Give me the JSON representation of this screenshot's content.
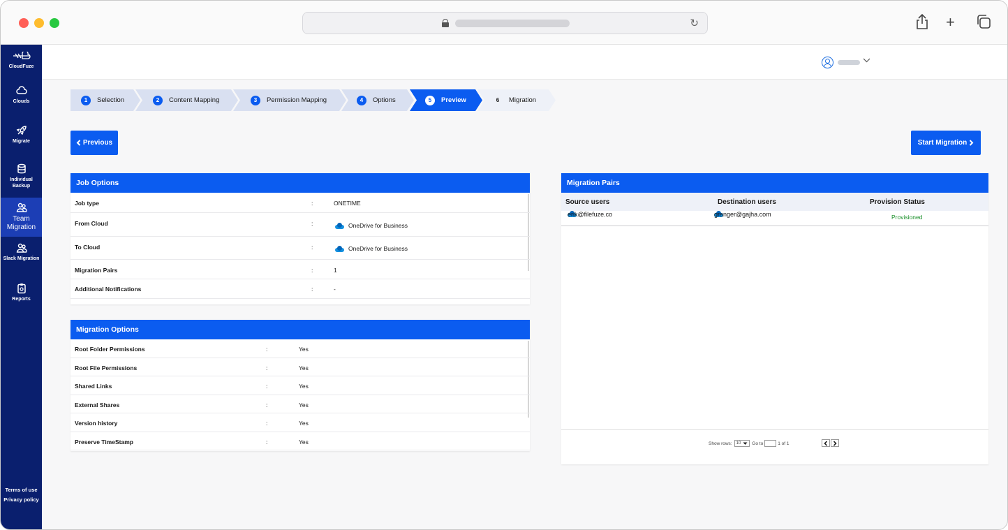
{
  "sidebar": {
    "logo_label": "CloudFuze",
    "items": [
      {
        "label": "Clouds",
        "icon": "cloud-icon"
      },
      {
        "label": "Migrate",
        "icon": "rocket-icon"
      },
      {
        "label": "Individual Backup",
        "icon": "database-icon"
      },
      {
        "label": "Team Migration",
        "icon": "team-icon"
      },
      {
        "label": "Slack Migration",
        "icon": "team-icon"
      },
      {
        "label": "Reports",
        "icon": "clipboard-icon"
      }
    ],
    "footer": {
      "terms": "Terms of use",
      "privacy": "Privacy policy"
    }
  },
  "stepper": [
    {
      "num": "1",
      "label": "Selection",
      "state": "done"
    },
    {
      "num": "2",
      "label": "Content Mapping",
      "state": "done"
    },
    {
      "num": "3",
      "label": "Permission Mapping",
      "state": "done"
    },
    {
      "num": "4",
      "label": "Options",
      "state": "done"
    },
    {
      "num": "5",
      "label": "Preview",
      "state": "current"
    },
    {
      "num": "6",
      "label": "Migration",
      "state": "future"
    }
  ],
  "buttons": {
    "previous": "Previous",
    "start": "Start Migration"
  },
  "job_options": {
    "title": "Job Options",
    "rows": [
      {
        "key": "Job type",
        "value": "ONETIME"
      },
      {
        "key": "From Cloud",
        "value": "OneDrive for Business"
      },
      {
        "key": "To Cloud",
        "value": "OneDrive for Business"
      },
      {
        "key": "Migration Pairs",
        "value": "1"
      },
      {
        "key": "Additional Notifications",
        "value": "-"
      }
    ]
  },
  "migration_options": {
    "title": "Migration Options",
    "rows": [
      {
        "key": "Root Folder Permissions",
        "value": "Yes"
      },
      {
        "key": "Root File Permissions",
        "value": "Yes"
      },
      {
        "key": "Shared Links",
        "value": "Yes"
      },
      {
        "key": "External Shares",
        "value": "Yes"
      },
      {
        "key": "Version history",
        "value": "Yes"
      },
      {
        "key": "Preserve TimeStamp",
        "value": "Yes"
      }
    ]
  },
  "separator": ":",
  "migration_pairs": {
    "title": "Migration Pairs",
    "columns": [
      "Source users",
      "Destination users",
      "Provision Status"
    ],
    "rows": [
      {
        "source": "erik@filefuze.co",
        "destination": "granger@gajha.com",
        "status": "Provisioned"
      }
    ],
    "pagination": {
      "show_rows": "Show rows:",
      "rows_value": "10",
      "go_to": "Go to",
      "page_of": "1 of 1"
    }
  },
  "colors": {
    "primary": "#0b5cf0",
    "sidebar": "#0a1f6e",
    "success": "#1a8f2a"
  }
}
